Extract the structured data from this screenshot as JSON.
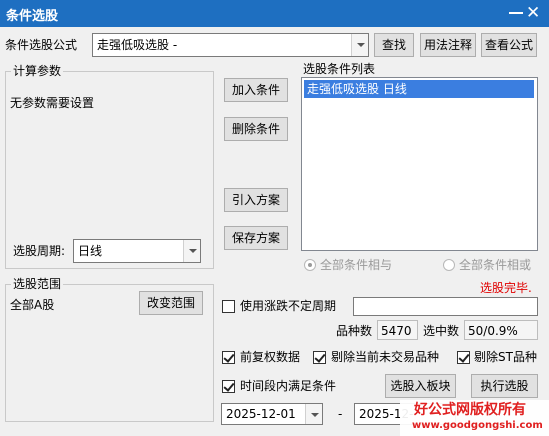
{
  "window": {
    "title": "条件选股"
  },
  "formula_row": {
    "label": "条件选股公式",
    "selected_formula": "走强低吸选股  -",
    "find_button": "查找",
    "usage_button": "用法注释",
    "view_button": "查看公式"
  },
  "params_group": {
    "title": "计算参数",
    "empty_text": "无参数需要设置",
    "period_label": "选股周期:",
    "period_value": "日线"
  },
  "condition_buttons": {
    "add": "加入条件",
    "delete": "删除条件",
    "import_plan": "引入方案",
    "save_plan": "保存方案"
  },
  "condition_list": {
    "title": "选股条件列表",
    "items": [
      "走强低吸选股  日线"
    ],
    "selected_index": 0
  },
  "logic": {
    "and_label": "全部条件相与",
    "or_label": "全部条件相或",
    "selected": "and"
  },
  "range_group": {
    "title": "选股范围",
    "value": "全部A股",
    "change_button": "改变范围"
  },
  "status_text": "选股完毕.",
  "status_color": "#e00000",
  "uncertain_period": {
    "label": "使用涨跌不定周期",
    "checked": false,
    "value": ""
  },
  "stats": {
    "count_label": "品种数",
    "count_value": "5470",
    "selected_label": "选中数",
    "selected_value": "50/0.9%"
  },
  "options": {
    "pre_adjust_label": "前复权数据",
    "pre_adjust_checked": true,
    "exclude_non_trading_label": "剔除当前未交易品种",
    "exclude_non_trading_checked": true,
    "exclude_st_label": "剔除ST品种",
    "exclude_st_checked": true,
    "time_range_label": "时间段内满足条件",
    "time_range_checked": true
  },
  "actions": {
    "to_block_button": "选股入板块",
    "execute_button": "执行选股"
  },
  "dates": {
    "start": "2025-12-01",
    "separator": "-",
    "end": "2025-12-"
  },
  "watermark": {
    "line1": "好公式网版权所有",
    "line2": "www.goodgongshi.com",
    "color": "#e02020"
  },
  "accent_color": "#1e6fc1",
  "selection_color": "#3b7ee0"
}
